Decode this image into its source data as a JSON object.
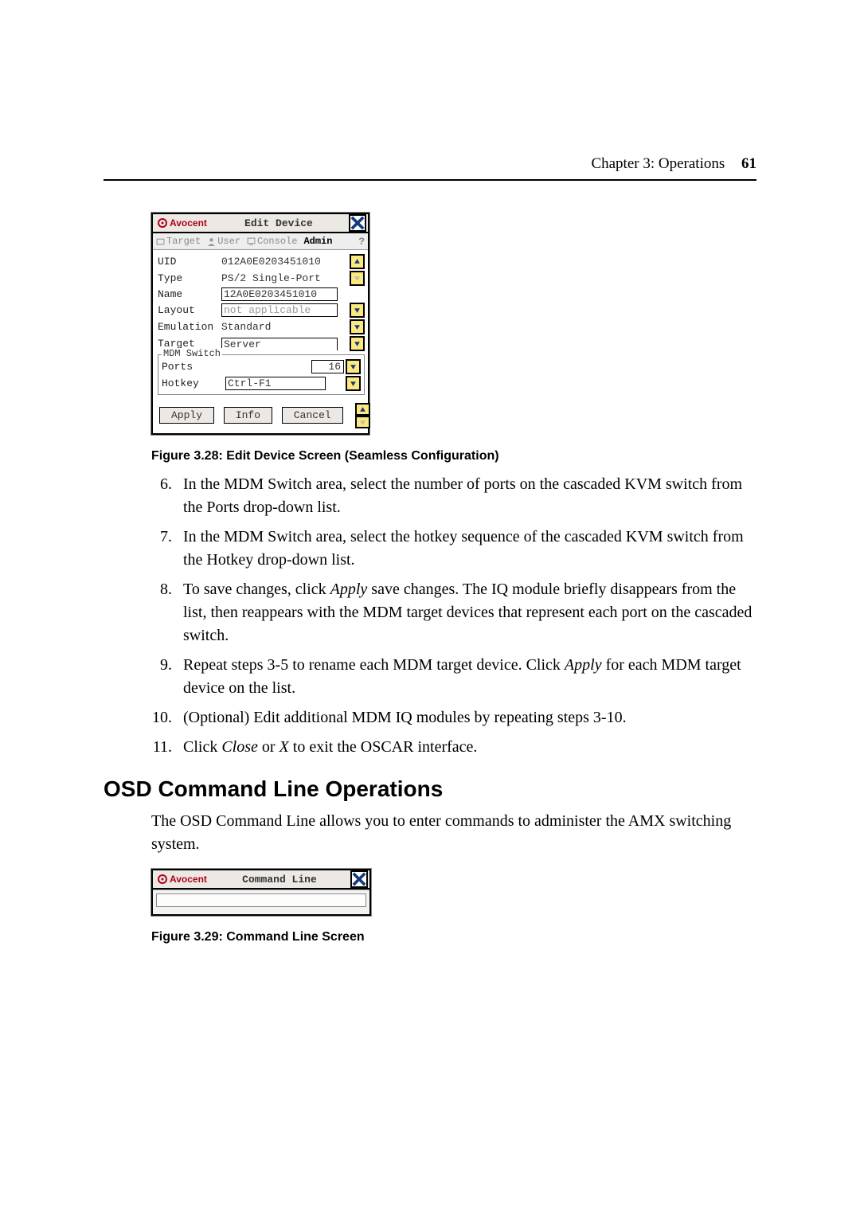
{
  "header": {
    "chapter": "Chapter 3: Operations",
    "page": "61"
  },
  "dlg1": {
    "logo": "Avocent",
    "title": "Edit Device",
    "tabs": {
      "target": "Target",
      "user": "User",
      "console": "Console",
      "admin": "Admin",
      "help": "?"
    },
    "rows": {
      "uid_label": "UID",
      "uid_value": "012A0E0203451010",
      "type_label": "Type",
      "type_value": "PS/2 Single-Port",
      "name_label": "Name",
      "name_value": "12A0E0203451010",
      "layout_label": "Layout",
      "layout_value": "not applicable",
      "emul_label": "Emulation",
      "emul_value": "Standard",
      "target_label": "Target",
      "target_value": "Server"
    },
    "mdm": {
      "legend": "MDM Switch",
      "ports_label": "Ports",
      "ports_value": "16",
      "hotkey_label": "Hotkey",
      "hotkey_value": "Ctrl-F1"
    },
    "buttons": {
      "apply": "Apply",
      "info": "Info",
      "cancel": "Cancel"
    }
  },
  "fig1_caption": "Figure 3.28: Edit Device Screen (Seamless Configuration)",
  "steps": {
    "6": "In the MDM Switch area, select the number of ports on the cascaded KVM switch from the Ports drop-down list.",
    "7": "In the MDM Switch area, select the hotkey sequence of the cascaded KVM switch from the Hotkey drop-down list.",
    "8a": "To save changes, click ",
    "8i": "Apply",
    "8b": " save changes. The IQ module briefly disappears from the list, then reappears with the MDM target devices that represent each port on the cascaded switch.",
    "9a": "Repeat steps 3-5 to rename each MDM target device. Click ",
    "9i": "Apply",
    "9b": " for each MDM target device on the list.",
    "10": "(Optional) Edit additional MDM IQ modules by repeating steps 3-10.",
    "11a": "Click ",
    "11i1": "Close",
    "11m": " or ",
    "11i2": "X",
    "11b": " to exit the OSCAR interface."
  },
  "section_heading": "OSD Command Line Operations",
  "section_intro": "The OSD Command Line allows you to enter commands to administer the AMX switching system.",
  "dlg2": {
    "logo": "Avocent",
    "title": "Command Line"
  },
  "fig2_caption": "Figure 3.29: Command Line Screen"
}
